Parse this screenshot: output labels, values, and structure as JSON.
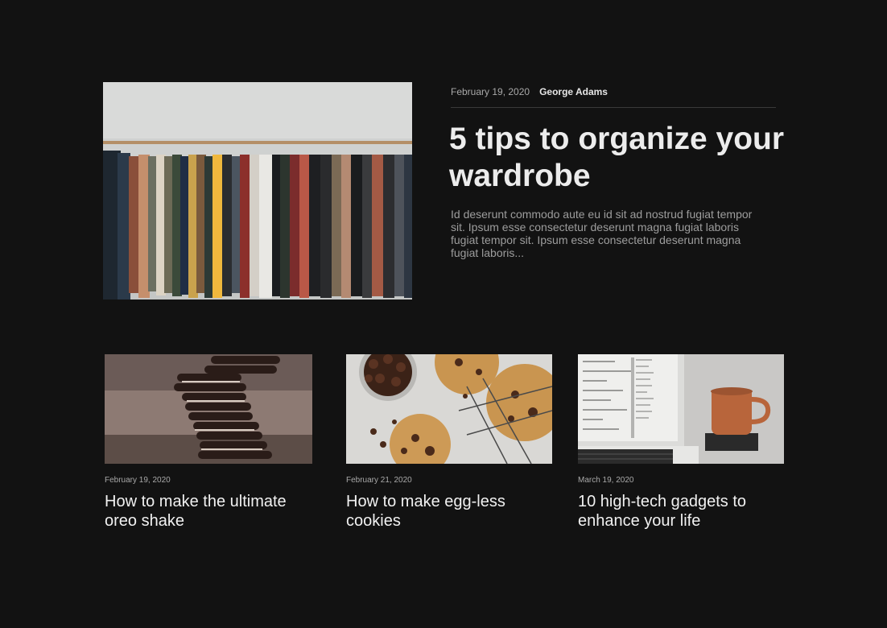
{
  "featured": {
    "date": "February 19, 2020",
    "author": "George Adams",
    "title": "5 tips to organize your wardrobe",
    "excerpt": "Id deserunt commodo aute eu id sit ad nostrud fugiat tempor sit. Ipsum esse consectetur deserunt magna fugiat laboris  fugiat tempor sit. Ipsum esse consectetur deserunt magna fugiat laboris..."
  },
  "cards": [
    {
      "date": "February 19, 2020",
      "title": "How to make the ultimate oreo shake"
    },
    {
      "date": "February 21, 2020",
      "title": "How to make egg-less cookies"
    },
    {
      "date": "March 19, 2020",
      "title": "10 high-tech gadgets to enhance your life"
    }
  ]
}
